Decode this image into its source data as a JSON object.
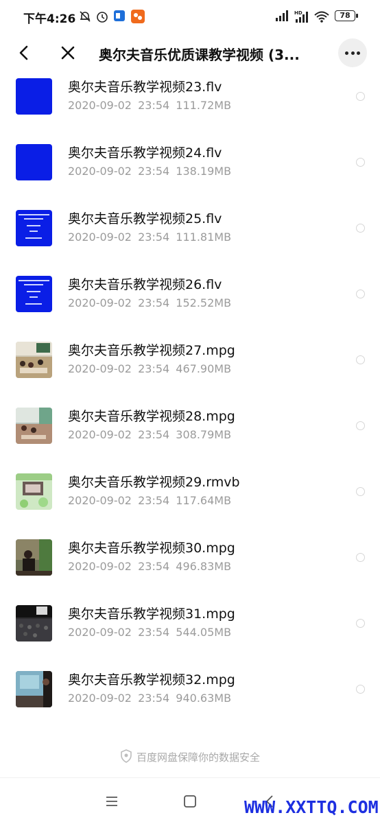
{
  "status_bar": {
    "time": "下午4:26",
    "battery": "78",
    "icons": [
      "mute-bell-icon",
      "alarm-icon",
      "app-icon-blue",
      "app-icon-orange",
      "signal-icon",
      "hd-signal-icon",
      "wifi-icon",
      "battery-icon"
    ]
  },
  "header": {
    "title": "奥尔夫音乐优质课教学视频 (3...",
    "back_icon": "back-arrow-icon",
    "close_icon": "close-icon",
    "more_icon": "more-icon"
  },
  "files": [
    {
      "name": "奥尔夫音乐教学视频23.flv",
      "date": "2020-09-02",
      "time": "23:54",
      "size": "111.72MB",
      "thumb": "blue"
    },
    {
      "name": "奥尔夫音乐教学视频24.flv",
      "date": "2020-09-02",
      "time": "23:54",
      "size": "138.19MB",
      "thumb": "blue"
    },
    {
      "name": "奥尔夫音乐教学视频25.flv",
      "date": "2020-09-02",
      "time": "23:54",
      "size": "111.81MB",
      "thumb": "blue-text"
    },
    {
      "name": "奥尔夫音乐教学视频26.flv",
      "date": "2020-09-02",
      "time": "23:54",
      "size": "152.52MB",
      "thumb": "blue-text"
    },
    {
      "name": "奥尔夫音乐教学视频27.mpg",
      "date": "2020-09-02",
      "time": "23:54",
      "size": "467.90MB",
      "thumb": "classroom"
    },
    {
      "name": "奥尔夫音乐教学视频28.mpg",
      "date": "2020-09-02",
      "time": "23:54",
      "size": "308.79MB",
      "thumb": "classroom2"
    },
    {
      "name": "奥尔夫音乐教学视频29.rmvb",
      "date": "2020-09-02",
      "time": "23:54",
      "size": "117.64MB",
      "thumb": "green"
    },
    {
      "name": "奥尔夫音乐教学视频30.mpg",
      "date": "2020-09-02",
      "time": "23:54",
      "size": "496.83MB",
      "thumb": "teacher"
    },
    {
      "name": "奥尔夫音乐教学视频31.mpg",
      "date": "2020-09-02",
      "time": "23:54",
      "size": "544.05MB",
      "thumb": "audience"
    },
    {
      "name": "奥尔夫音乐教学视频32.mpg",
      "date": "2020-09-02",
      "time": "23:54",
      "size": "940.63MB",
      "thumb": "stage"
    }
  ],
  "footer": {
    "security_note": "百度网盘保障你的数据安全",
    "shield_icon": "shield-icon"
  },
  "nav_bar": {
    "icons": [
      "menu-icon",
      "home-square-icon",
      "back-nav-icon"
    ]
  },
  "watermark": "WWW.XXTTQ.COM"
}
